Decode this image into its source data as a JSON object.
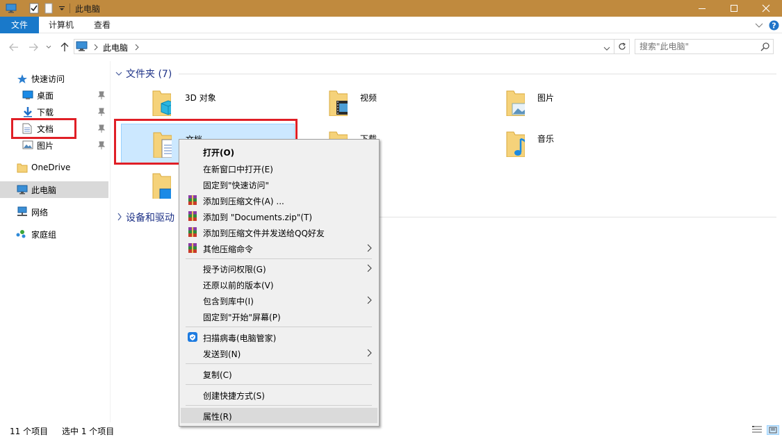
{
  "titlebar": {
    "title": "此电脑",
    "accent": "#c08a3e",
    "controls": [
      "minimize-icon",
      "maximize-icon",
      "close-icon"
    ]
  },
  "ribbon": {
    "tabs": [
      "文件",
      "计算机",
      "查看"
    ],
    "active_tab_color": "#1979ca"
  },
  "address": {
    "crumbs": [
      "此电脑"
    ],
    "search_placeholder": "搜索\"此电脑\""
  },
  "sidebar": {
    "items": [
      {
        "label": "快速访问",
        "icon": "star-icon"
      },
      {
        "label": "桌面",
        "icon": "desktop-icon",
        "pinned": true
      },
      {
        "label": "下载",
        "icon": "download-icon",
        "pinned": true
      },
      {
        "label": "文档",
        "icon": "document-icon",
        "pinned": true
      },
      {
        "label": "图片",
        "icon": "picture-icon",
        "pinned": true
      },
      {
        "label": "OneDrive",
        "icon": "folder-icon"
      },
      {
        "label": "此电脑",
        "icon": "computer-icon",
        "selected": true
      },
      {
        "label": "网络",
        "icon": "network-icon"
      },
      {
        "label": "家庭组",
        "icon": "homegroup-icon"
      }
    ]
  },
  "content": {
    "folders_header": "文件夹 (7)",
    "devices_header": "设备和驱动",
    "folders": [
      "3D 对象",
      "视频",
      "图片",
      "文档",
      "下载",
      "音乐"
    ]
  },
  "context_menu": {
    "items": [
      {
        "label": "打开(O)",
        "bold": true
      },
      {
        "label": "在新窗口中打开(E)"
      },
      {
        "label": "固定到\"快速访问\""
      },
      {
        "label": "添加到压缩文件(A) ...",
        "icon": "winrar-icon"
      },
      {
        "label": "添加到 \"Documents.zip\"(T)",
        "icon": "winrar-icon"
      },
      {
        "label": "添加到压缩文件并发送给QQ好友",
        "icon": "winrar-icon"
      },
      {
        "label": "其他压缩命令",
        "icon": "winrar-icon",
        "submenu": true
      },
      {
        "label": "授予访问权限(G)",
        "submenu": true
      },
      {
        "label": "还原以前的版本(V)"
      },
      {
        "label": "包含到库中(I)",
        "submenu": true
      },
      {
        "label": "固定到\"开始\"屏幕(P)"
      },
      {
        "label": "扫描病毒(电脑管家)",
        "icon": "shield-icon"
      },
      {
        "label": "发送到(N)",
        "submenu": true
      },
      {
        "label": "复制(C)"
      },
      {
        "label": "创建快捷方式(S)"
      },
      {
        "label": "属性(R)",
        "hover": true
      }
    ]
  },
  "status": {
    "count": "11 个项目",
    "selected": "选中 1 个项目"
  }
}
